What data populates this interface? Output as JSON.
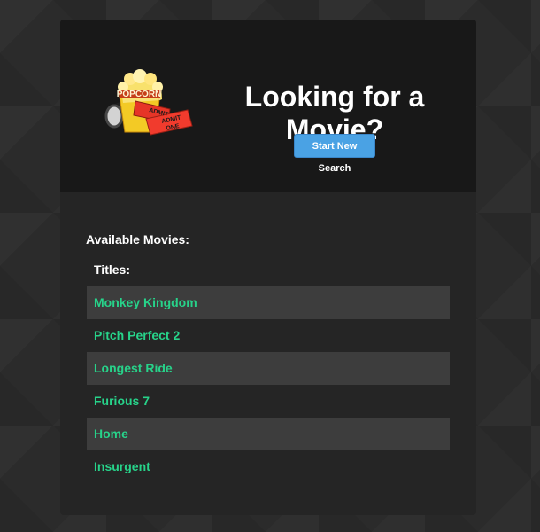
{
  "hero": {
    "title": "Looking for a Movie?",
    "button_label": "Start New Search"
  },
  "movies": {
    "section_heading": "Available Movies:",
    "column_heading": "Titles:",
    "items": [
      "Monkey Kingdom",
      "Pitch Perfect 2",
      "Longest Ride",
      "Furious 7",
      "Home",
      "Insurgent"
    ]
  },
  "colors": {
    "background": "#2b2b2b",
    "panel": "#252525",
    "hero": "#181818",
    "button": "#4aa2e4",
    "link": "#27d38a",
    "stripe": "#3d3d3d"
  },
  "icons": {
    "hero_image": "popcorn-and-tickets-icon"
  }
}
